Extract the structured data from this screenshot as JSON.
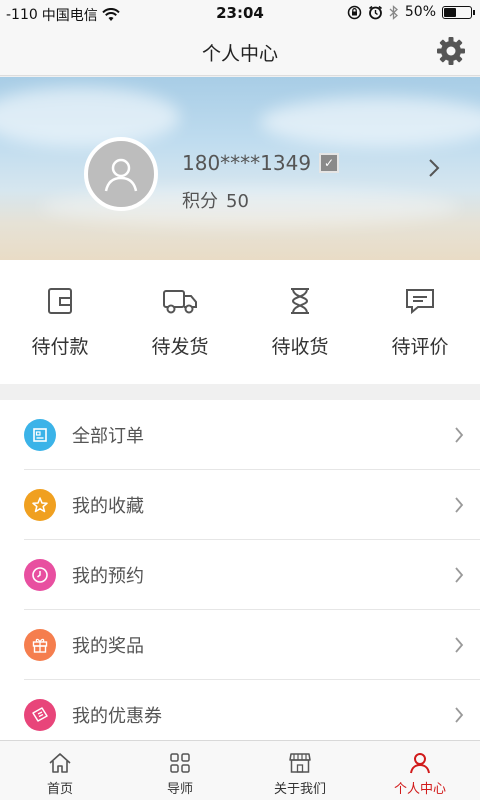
{
  "status_bar": {
    "signal": "-110",
    "carrier": "中国电信",
    "time": "23:04",
    "battery": "50%",
    "battery_level": 0.5
  },
  "nav": {
    "title": "个人中心",
    "settings_icon": "gear-icon"
  },
  "profile": {
    "phone": "180****1349",
    "points_label": "积分",
    "points_value": "50"
  },
  "order_status": [
    {
      "label": "待付款",
      "icon": "wallet-icon"
    },
    {
      "label": "待发货",
      "icon": "truck-icon"
    },
    {
      "label": "待收货",
      "icon": "hourglass-icon"
    },
    {
      "label": "待评价",
      "icon": "comment-icon"
    }
  ],
  "menu": [
    {
      "label": "全部订单",
      "icon": "order-list-icon",
      "color": "#3bb3e8"
    },
    {
      "label": "我的收藏",
      "icon": "star-icon",
      "color": "#f0a020"
    },
    {
      "label": "我的预约",
      "icon": "clock-icon",
      "color": "#e84fa0"
    },
    {
      "label": "我的奖品",
      "icon": "gift-icon",
      "color": "#f57e4e"
    },
    {
      "label": "我的优惠券",
      "icon": "coupon-icon",
      "color": "#e8457a"
    }
  ],
  "tabs": [
    {
      "label": "首页",
      "icon": "home-icon"
    },
    {
      "label": "导师",
      "icon": "grid-icon"
    },
    {
      "label": "关于我们",
      "icon": "store-icon"
    },
    {
      "label": "个人中心",
      "icon": "user-icon",
      "active": true
    }
  ],
  "colors": {
    "accent": "#d11a1a",
    "background": "#f0f0f0"
  }
}
